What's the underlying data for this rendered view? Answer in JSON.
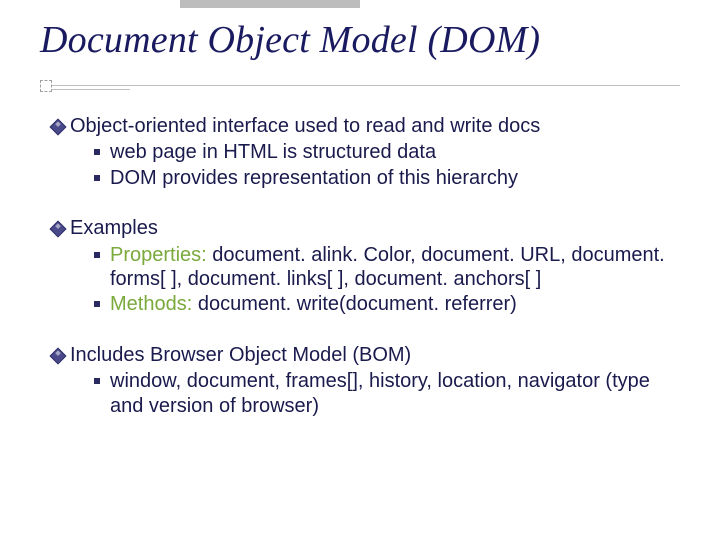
{
  "title": "Document Object Model (DOM)",
  "items": [
    {
      "lead": "Object-oriented interface used to read and write docs",
      "subs": [
        {
          "text": "web page in HTML is structured data"
        },
        {
          "text": "DOM provides representation of this hierarchy"
        }
      ]
    },
    {
      "lead": "Examples",
      "subs": [
        {
          "label": "Properties:",
          "text": " document. alink. Color, document. URL, document. forms[ ], document. links[ ], document. anchors[ ]"
        },
        {
          "label": "Methods:",
          "text": "  document. write(document. referrer)"
        }
      ]
    },
    {
      "lead": "Includes Browser Object Model (BOM)",
      "subs": [
        {
          "text": "window, document, frames[], history, location, navigator (type and version of browser)"
        }
      ]
    }
  ]
}
